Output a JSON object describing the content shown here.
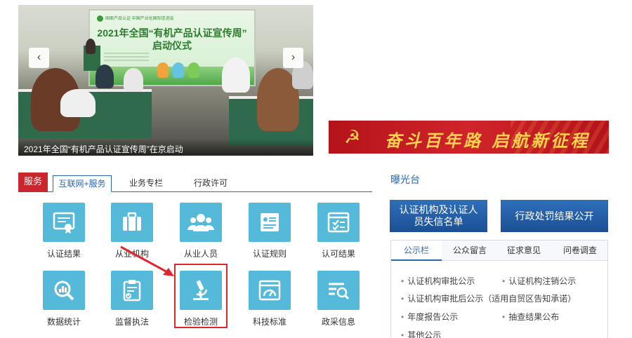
{
  "carousel": {
    "caption": "2021年全国“有机产品认证宣传周”在京启动",
    "screen_logo": "国家产品认证 中国产业化国际促进会",
    "screen_title_1": "2021年全国“有机产品认证宣传周”",
    "screen_title_2": "启动仪式",
    "prev_glyph": "‹",
    "next_glyph": "›"
  },
  "banner": {
    "slogan": "奋斗百年路 启航新征程",
    "emblem": "☭"
  },
  "service": {
    "head": "服务",
    "tabs": [
      {
        "label": "互联网+服务",
        "active": true
      },
      {
        "label": "业务专栏",
        "active": false
      },
      {
        "label": "行政许可",
        "active": false
      }
    ],
    "items": [
      {
        "label": "认证结果",
        "icon": "certificate-icon"
      },
      {
        "label": "从业机构",
        "icon": "briefcase-icon"
      },
      {
        "label": "从业人员",
        "icon": "people-icon"
      },
      {
        "label": "认证规则",
        "icon": "document-rules-icon"
      },
      {
        "label": "认可结果",
        "icon": "checklist-window-icon"
      },
      {
        "label": "数据统计",
        "icon": "magnifier-chart-icon"
      },
      {
        "label": "监督执法",
        "icon": "clipboard-check-icon"
      },
      {
        "label": "检验检测",
        "icon": "microscope-icon"
      },
      {
        "label": "科技标准",
        "icon": "gauge-window-icon"
      },
      {
        "label": "政采信息",
        "icon": "search-list-icon"
      }
    ]
  },
  "right": {
    "exposure_title": "曝光台",
    "btn_dishonest": "认证机构及认证人员失信名单",
    "btn_penalty": "行政处罚结果公开",
    "tabs": [
      {
        "label": "公示栏",
        "active": true
      },
      {
        "label": "公众留言",
        "active": false
      },
      {
        "label": "征求意见",
        "active": false
      },
      {
        "label": "问卷调查",
        "active": false
      }
    ],
    "notices": [
      "认证机构审批公示",
      "认证机构注销公示",
      "认证机构审批后公示（适用自贸区告知承诺）",
      "年度报告公示",
      "抽查结果公布",
      "其他公示"
    ]
  },
  "colors": {
    "accent_blue": "#2b66b0",
    "tile_blue": "#55b9d9",
    "service_red": "#c9272d",
    "highlight_red": "#e0262c"
  }
}
